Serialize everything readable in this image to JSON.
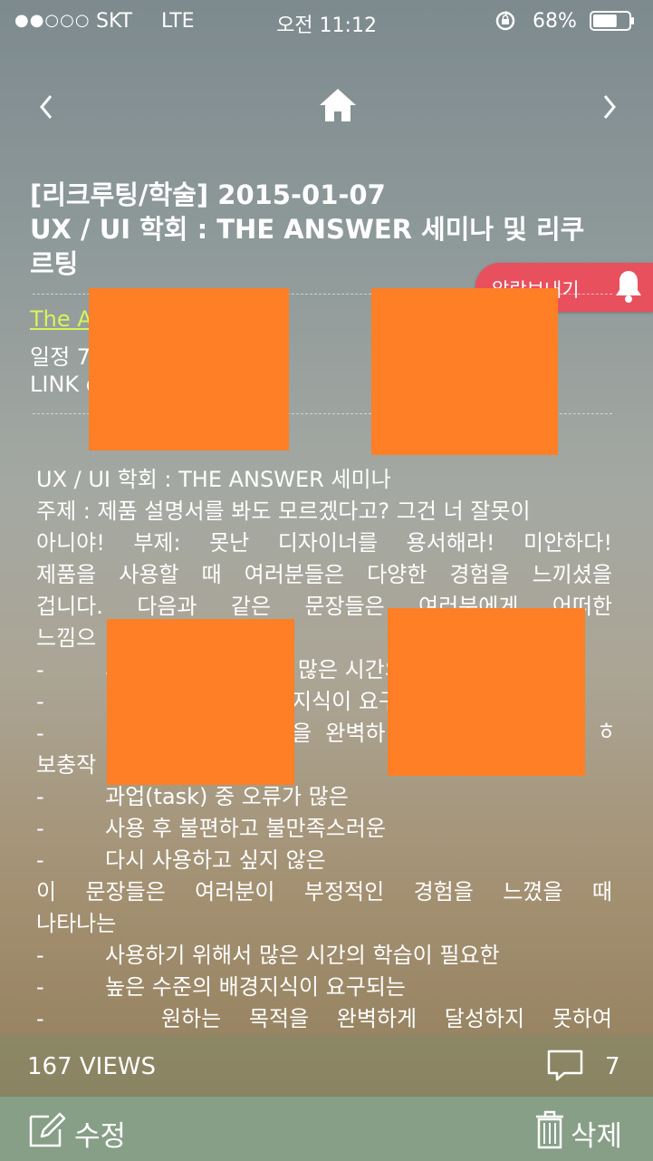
{
  "status_bar": {
    "signal": "●●○○○",
    "carrier": "SKT",
    "network": "LTE",
    "time": "오전 11:12",
    "rotation_icon": "rotation-lock-icon",
    "battery": "68%",
    "battery_level": 0.68
  },
  "nav": {
    "prev_icon": "chevron-left-icon",
    "home_icon": "home-icon",
    "next_icon": "chevron-right-icon"
  },
  "post": {
    "title_lines": [
      "[리크루팅/학술] 2015-01-07",
      "UX / UI 학회 : THE ANSWER 세미나 및 리쿠",
      "르팅"
    ],
    "notify_label": "알람보내기",
    "link_title": "The A",
    "schedule": "일정 7                                    7 ~ 201",
    "link": "LINK                              ong.edu                        nin/..."
  },
  "body": {
    "line1": "UX / UI 학회 : THE ANSWER 세미나",
    "line2": "주제 : 제품 설명서를 봐도 모르겠다고? 그건 너 잘못이",
    "line3": [
      "아니야!",
      "부제:",
      "못난",
      "디자이너를",
      "용서해라!",
      "미안하다!"
    ],
    "line4": [
      "제품을",
      "사용할",
      "때",
      "여러분들은",
      "다양한",
      "경험을",
      "느끼셨을"
    ],
    "line5": [
      "겁니다.",
      "다음과",
      "같은",
      "문장들은",
      "여러분에게",
      "어떠한"
    ],
    "line6": "느낌으",
    "bullet1": "시                         많은 시간의",
    "bullet2": "                           지식이 요구",
    "bullet3": "                           을  완벽하                               하여",
    "line_cont": "보충작",
    "bullet4": "과업(task) 중 오류가 많은",
    "bullet5": "사용 후 불편하고 불만족스러운",
    "bullet6": "다시 사용하고 싶지 않은",
    "line7": [
      "이",
      "문장들은",
      "여러분이",
      "부정적인",
      "경험을",
      "느꼈을",
      "때"
    ],
    "line8": "나타나는",
    "bullet7": "사용하기 위해서 많은 시간의 학습이 필요한",
    "bullet8": "높은 수준의 배경지식이 요구되는",
    "bullet9": [
      "원하는",
      "목적을",
      "완벽하게",
      "달성하지",
      "못하여"
    ],
    "dash": "-"
  },
  "stats": {
    "views": "167 VIEWS",
    "comment_icon": "comment-icon",
    "comment_count": "7"
  },
  "actions": {
    "edit_label": "수정",
    "edit_icon": "edit-icon",
    "delete_label": "삭제",
    "delete_icon": "trash-icon"
  },
  "colors": {
    "notify_bg": "#e8505e",
    "link": "#d8f35a",
    "redaction": "#fe7f25",
    "bottom_bar": "#879e87"
  }
}
